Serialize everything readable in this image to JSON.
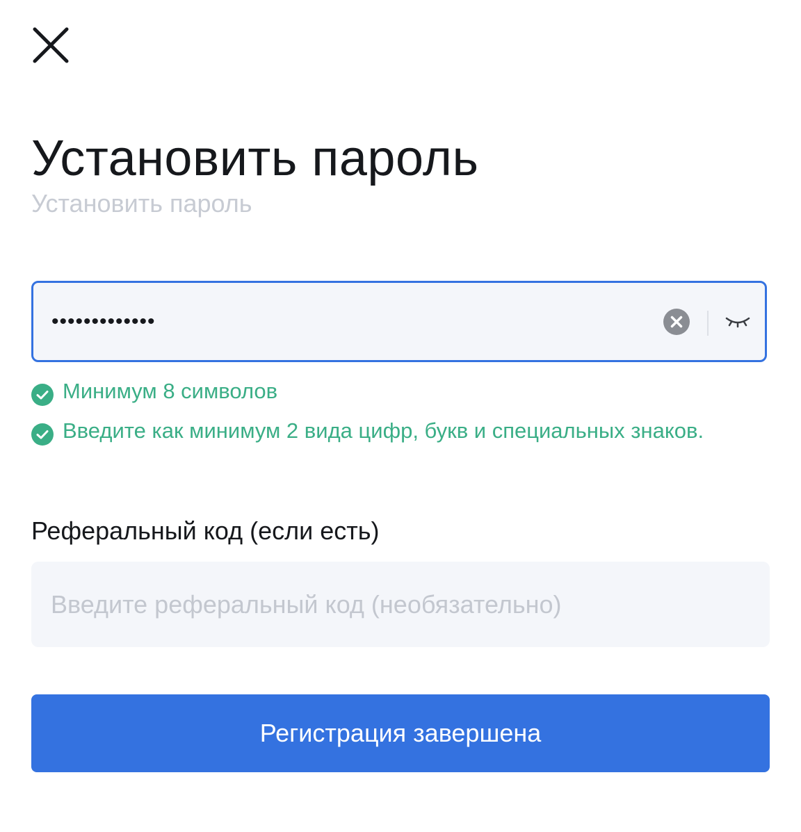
{
  "header": {
    "close_icon": "close-icon",
    "title": "Установить пароль",
    "subtitle": "Установить пароль"
  },
  "password": {
    "value": "•••••••••••••",
    "clear_icon": "clear-icon",
    "visibility_icon": "eye-closed-icon",
    "focus_border_color": "#3472e0"
  },
  "rules": [
    {
      "text": "Минимум 8 символов",
      "status": "passed",
      "icon": "check-circle-icon"
    },
    {
      "text": "Введите как минимум 2 вида цифр, букв и специальных знаков.",
      "status": "passed",
      "icon": "check-circle-icon"
    }
  ],
  "referral": {
    "label": "Реферальный код (если есть)",
    "placeholder": "Введите реферальный код (необязательно)",
    "value": ""
  },
  "submit": {
    "label": "Регистрация завершена",
    "color": "#3472e0"
  },
  "colors": {
    "success": "#3aae86",
    "accent": "#3472e0",
    "muted_text": "#c7cbd3"
  }
}
